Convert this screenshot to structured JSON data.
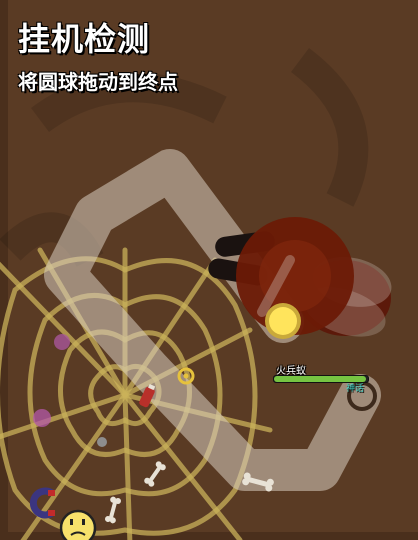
{
  "header": {
    "title": "挂机检测",
    "subtitle": "将圆球拖动到终点"
  },
  "mob": {
    "name": "火兵蚁",
    "rarity": "神话",
    "health_fraction": 0.98
  },
  "colors": {
    "background": "#5a3b24",
    "path": "#d8cdc0",
    "cobweb": "#c9b25a",
    "mob_body": "#7a1a08",
    "drag_ball": "#ffe45c"
  },
  "icons": [
    "drag-ball-icon",
    "goal-ring-icon",
    "cobweb-icon",
    "fire-ant-icon",
    "bone-icon",
    "magnet-icon",
    "petal-icon",
    "player-face-icon"
  ]
}
